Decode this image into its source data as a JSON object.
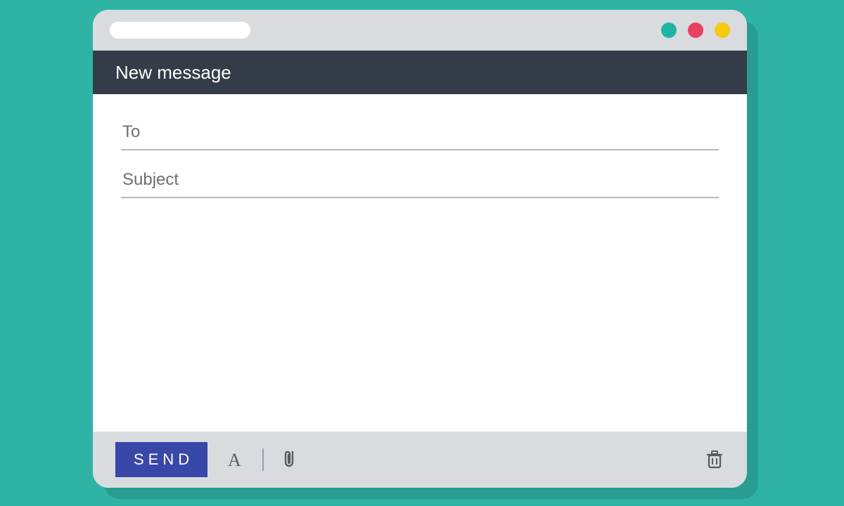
{
  "titlebar": {
    "dots": {
      "minimize_color": "#1fb3a3",
      "close_color": "#e8415f",
      "maximize_color": "#f4c90e"
    }
  },
  "header": {
    "title": "New message"
  },
  "fields": {
    "to_placeholder": "To",
    "subject_placeholder": "Subject"
  },
  "footer": {
    "send_label": "SEND"
  }
}
